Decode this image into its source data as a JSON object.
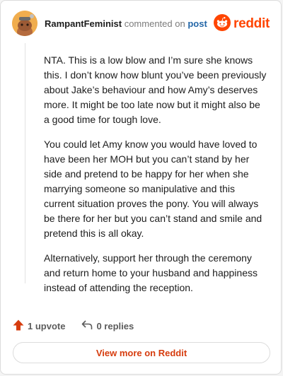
{
  "header": {
    "author": "RampantFeminist",
    "action_text": "commented on",
    "post_link": "post",
    "brand": "reddit",
    "avatar_icon": "snoo-avatar-icon",
    "logo_icon": "reddit-snoo-icon"
  },
  "comment": {
    "paragraphs": [
      "NTA. This is a low blow and I’m sure she knows this. I don’t know how blunt you’ve been previously about Jake’s behaviour and how Amy’s deserves more. It might be too late now but it might also be a good time for tough love.",
      "You could let Amy know you would have loved to have been her MOH but you can’t stand by her side and pretend to be happy for her when she marrying someone so manipulative and this current situation proves the pony. You will always be there for her but you can’t stand and smile and pretend this is all okay.",
      "Alternatively, support her through the ceremony and return home to your husband and happiness instead of attending the reception."
    ]
  },
  "actions": {
    "upvote_label": "1 upvote",
    "replies_label": "0 replies",
    "upvote_icon": "upvote-arrow-icon",
    "reply_icon": "reply-arrow-icon"
  },
  "footer": {
    "view_more_label": "View more on Reddit"
  },
  "colors": {
    "brand": "#ff4500",
    "link": "#2467a8",
    "upvote": "#d63c0e"
  }
}
